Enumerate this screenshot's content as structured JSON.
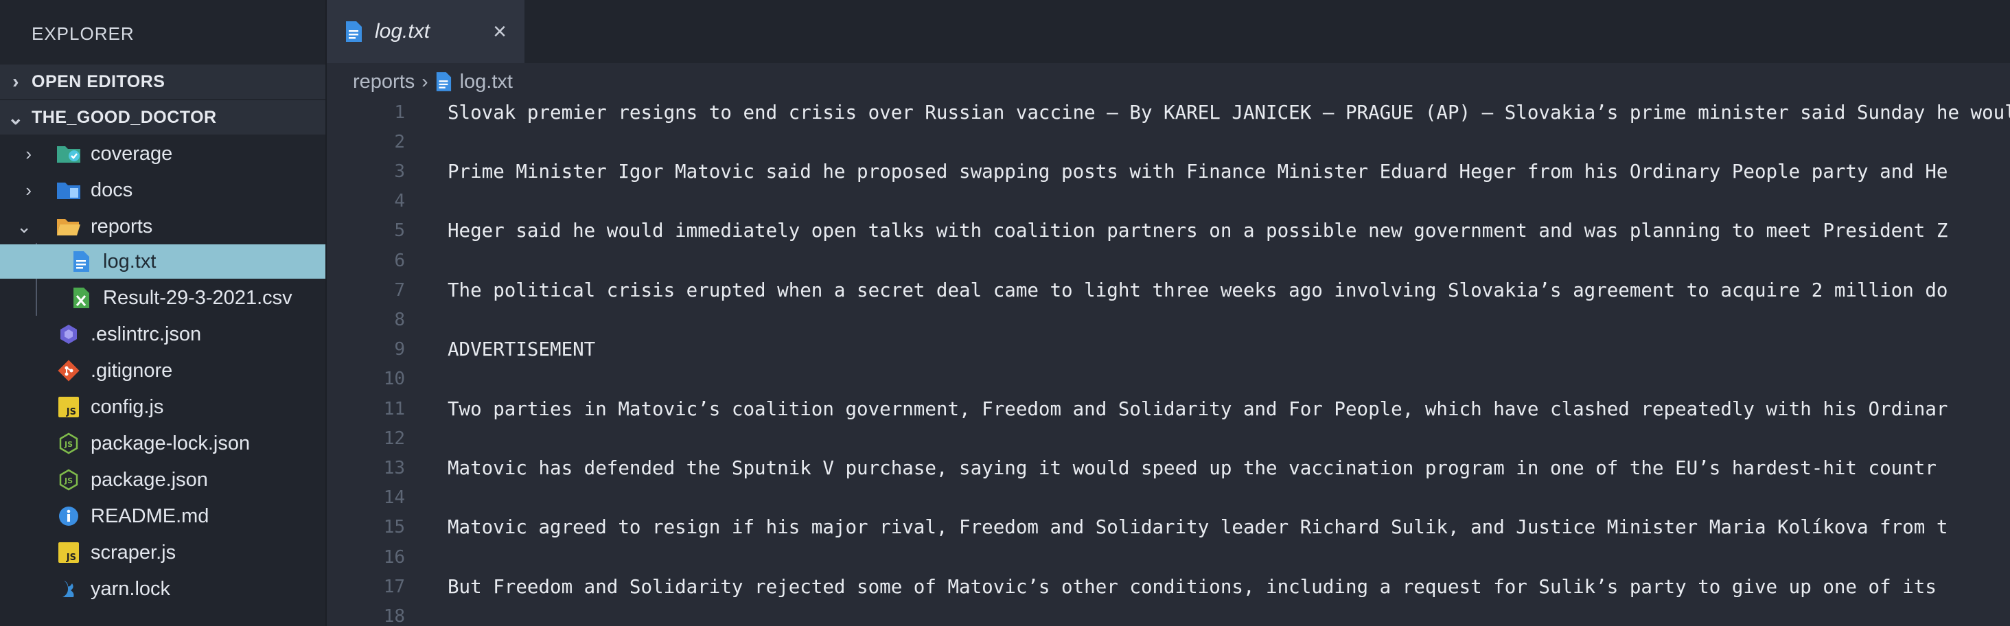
{
  "sidebar": {
    "title": "EXPLORER",
    "open_editors": "OPEN EDITORS",
    "project": "THE_GOOD_DOCTOR",
    "items": [
      {
        "label": "coverage",
        "icon": "folder-coverage-icon",
        "chevron": "›"
      },
      {
        "label": "docs",
        "icon": "folder-docs-icon",
        "chevron": "›"
      },
      {
        "label": "reports",
        "icon": "folder-open-icon",
        "chevron": "⌄"
      },
      {
        "label": "log.txt",
        "icon": "text-file-icon"
      },
      {
        "label": "Result-29-3-2021.csv",
        "icon": "csv-file-icon"
      },
      {
        "label": ".eslintrc.json",
        "icon": "eslint-icon"
      },
      {
        "label": ".gitignore",
        "icon": "git-icon"
      },
      {
        "label": "config.js",
        "icon": "js-file-icon"
      },
      {
        "label": "package-lock.json",
        "icon": "nodejs-icon"
      },
      {
        "label": "package.json",
        "icon": "nodejs-icon"
      },
      {
        "label": "README.md",
        "icon": "info-icon"
      },
      {
        "label": "scraper.js",
        "icon": "js-file-icon"
      },
      {
        "label": "yarn.lock",
        "icon": "yarn-icon"
      }
    ]
  },
  "tab": {
    "label": "log.txt",
    "close": "×"
  },
  "breadcrumb": {
    "folder": "reports",
    "separator": "›",
    "file": "log.txt"
  },
  "editor": {
    "lines": [
      {
        "n": "1",
        "text": "Slovak premier resigns to end crisis over Russian vaccine — By KAREL JANICEK — PRAGUE (AP) — Slovakia’s prime minister said Sunday he would resign"
      },
      {
        "n": "2",
        "text": ""
      },
      {
        "n": "3",
        "text": "Prime Minister Igor Matovic said he proposed swapping posts with Finance Minister Eduard Heger from his Ordinary People party and He"
      },
      {
        "n": "4",
        "text": ""
      },
      {
        "n": "5",
        "text": "Heger said he would immediately open talks with coalition partners on a possible new government and was planning to meet President Z"
      },
      {
        "n": "6",
        "text": ""
      },
      {
        "n": "7",
        "text": "The political crisis erupted when a secret deal came to light three weeks ago involving Slovakia’s agreement to acquire 2 million do"
      },
      {
        "n": "8",
        "text": ""
      },
      {
        "n": "9",
        "text": "ADVERTISEMENT"
      },
      {
        "n": "10",
        "text": ""
      },
      {
        "n": "11",
        "text": "Two parties in Matovic’s coalition government, Freedom and Solidarity and For People, which have clashed repeatedly with his Ordinar"
      },
      {
        "n": "12",
        "text": ""
      },
      {
        "n": "13",
        "text": "Matovic has defended the Sputnik V purchase, saying it would speed up the vaccination program in one of the EU’s hardest-hit countr"
      },
      {
        "n": "14",
        "text": ""
      },
      {
        "n": "15",
        "text": "Matovic agreed to resign if his major rival, Freedom and Solidarity leader Richard Sulik, and Justice Minister Maria Kolíkova from t"
      },
      {
        "n": "16",
        "text": ""
      },
      {
        "n": "17",
        "text": "But Freedom and Solidarity rejected some of Matovic’s other conditions, including a request for Sulik’s party to give up one of its"
      },
      {
        "n": "18",
        "text": ""
      }
    ]
  },
  "colors": {
    "selection": "#8ec2d2",
    "file_icon_blue": "#4a9be8",
    "js_yellow": "#e8c930",
    "node_green": "#7fbb4b",
    "git_orange": "#e0552f",
    "eslint_purple": "#6a62d4"
  }
}
